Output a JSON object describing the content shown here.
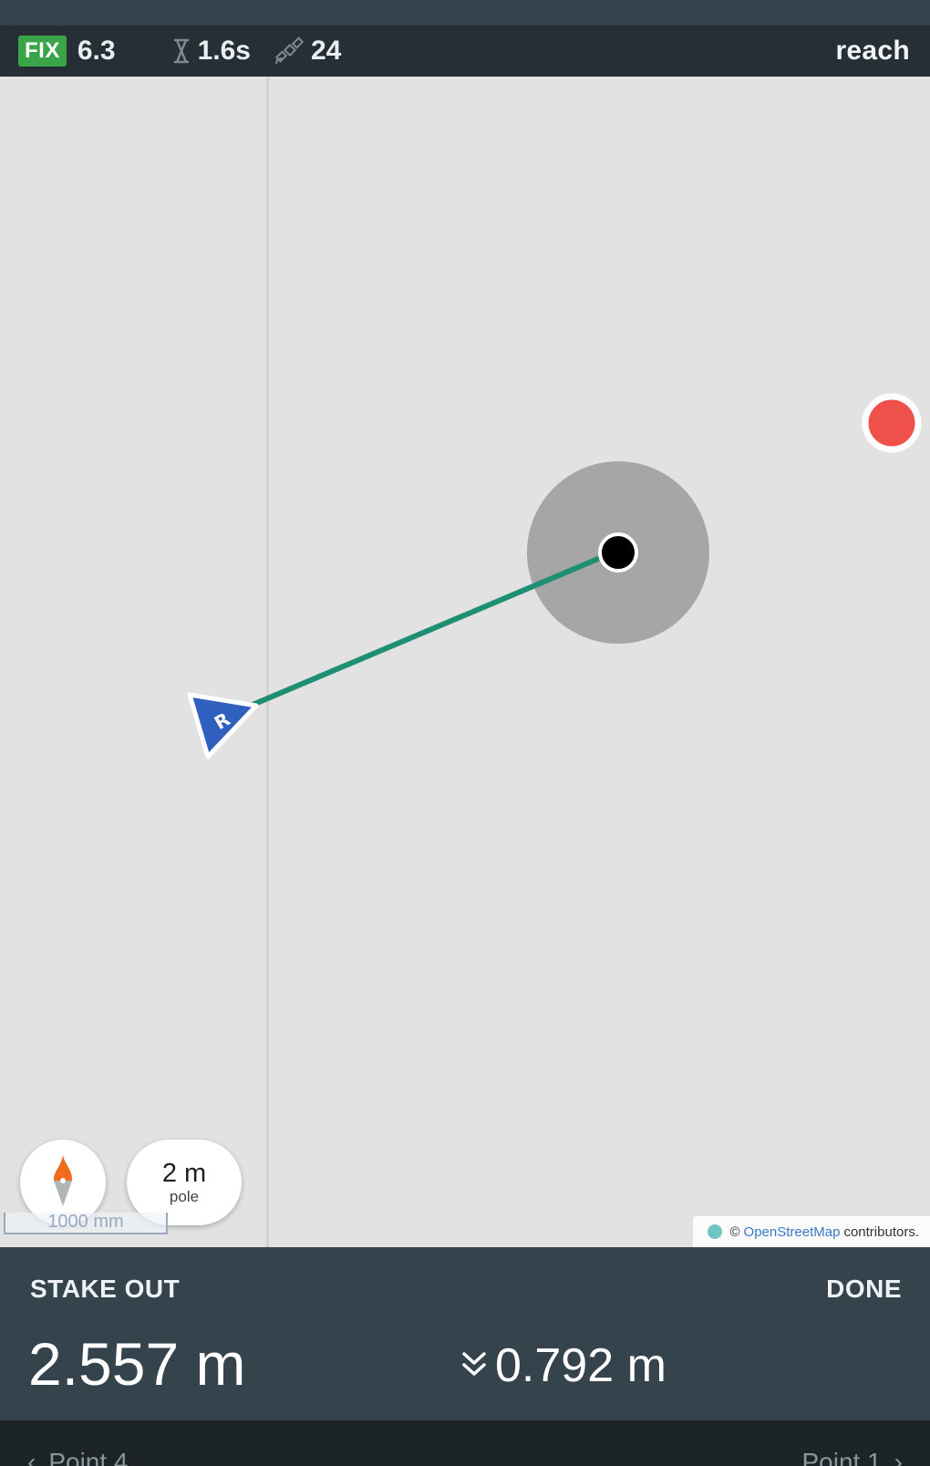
{
  "status_bar": {
    "fix_badge": "FIX",
    "fix_value": "6.3",
    "age_value": "1.6s",
    "satellites_value": "24",
    "brand": "reach",
    "icons": {
      "age": "hourglass-icon",
      "satellites": "satellite-icon"
    }
  },
  "map": {
    "pole_value": "2 m",
    "pole_label": "pole",
    "scale_label": "1000 mm",
    "attribution_prefix": "©",
    "attribution_link": "OpenStreetMap",
    "attribution_suffix": "contributors.",
    "colors": {
      "background": "#e2e2e2",
      "tolerance_circle": "#a6a6a6",
      "target_point": "#000000",
      "guide_line": "#1f8f73",
      "rover_marker": "#2f5fbf",
      "other_point": "#f0504a"
    },
    "icons": {
      "compass": "compass-icon",
      "rover": "rover-arrow-icon"
    }
  },
  "stakeout": {
    "title": "STAKE OUT",
    "done_label": "DONE",
    "distance": "2.557 m",
    "height_diff": "0.792 m",
    "height_icon": "double-chevron-down-icon"
  },
  "navigation": {
    "prev_label": "Point 4",
    "next_label": "Point 1"
  }
}
